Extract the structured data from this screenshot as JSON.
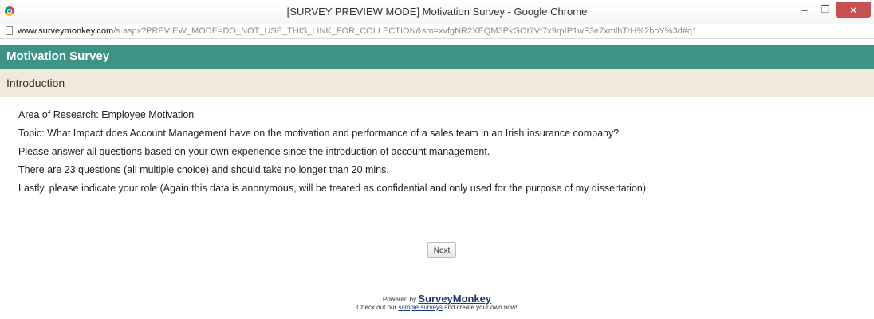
{
  "window": {
    "title": "[SURVEY PREVIEW MODE] Motivation Survey - Google Chrome",
    "controls": {
      "minimize": "–",
      "restore": "❐",
      "close": "×"
    }
  },
  "address_bar": {
    "host": "www.surveymonkey.com",
    "path": "/s.aspx?PREVIEW_MODE=DO_NOT_USE_THIS_LINK_FOR_COLLECTION&sm=xvfgNR2XEQM3PkGOt7Vt7x9rpIP1wF3e7xmlhTrH%2boY%3d#q1"
  },
  "survey": {
    "title": "Motivation Survey",
    "page_title": "Introduction",
    "paragraphs": [
      "Area of Research: Employee Motivation",
      "Topic: What Impact does Account Management have on the motivation and performance of a sales team in an Irish insurance company?",
      "Please answer all questions based on your own experience since the introduction of account management.",
      "There are 23 questions (all multiple choice) and should take no longer than 20 mins.",
      "Lastly, please indicate your role (Again this data is anonymous, will be treated as confidential and only used for the purpose of my dissertation)"
    ],
    "next_label": "Next"
  },
  "footer": {
    "powered_by": "Powered by",
    "brand": "SurveyMonkey",
    "check_prefix": "Check out our",
    "sample_link": "sample surveys",
    "check_suffix": "and create your own now!"
  },
  "colors": {
    "header_bg": "#3d9486",
    "page_title_bg": "#f1e9db",
    "close_button": "#c75050"
  }
}
